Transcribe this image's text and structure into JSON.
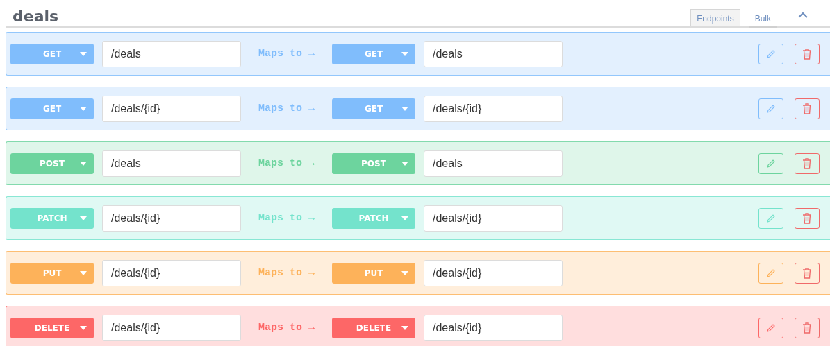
{
  "title": "deals",
  "tabs": [
    {
      "label": "Endpoints",
      "selected": true
    },
    {
      "label": "Bulk",
      "selected": false
    }
  ],
  "endpoints": [
    {
      "method": "GET",
      "path": "/deals",
      "mapping_label": "Maps to →",
      "target_method": "GET",
      "target_path": "/deals",
      "color": "#80bdfc"
    },
    {
      "method": "GET",
      "path": "/deals/{id}",
      "mapping_label": "Maps to →",
      "target_method": "GET",
      "target_path": "/deals/{id}",
      "color": "#80bdfc"
    },
    {
      "method": "POST",
      "path": "/deals",
      "mapping_label": "Maps to →",
      "target_method": "POST",
      "target_path": "/deals",
      "color": "#6dd49e"
    },
    {
      "method": "PATCH",
      "path": "/deals/{id}",
      "mapping_label": "Maps to →",
      "target_method": "PATCH",
      "target_path": "/deals/{id}",
      "color": "#74e3cc"
    },
    {
      "method": "PUT",
      "path": "/deals/{id}",
      "mapping_label": "Maps to →",
      "target_method": "PUT",
      "target_path": "/deals/{id}",
      "color": "#fdb25a"
    },
    {
      "method": "DELETE",
      "path": "/deals/{id}",
      "mapping_label": "Maps to →",
      "target_method": "DELETE",
      "target_path": "/deals/{id}",
      "color": "#fd6767"
    }
  ]
}
